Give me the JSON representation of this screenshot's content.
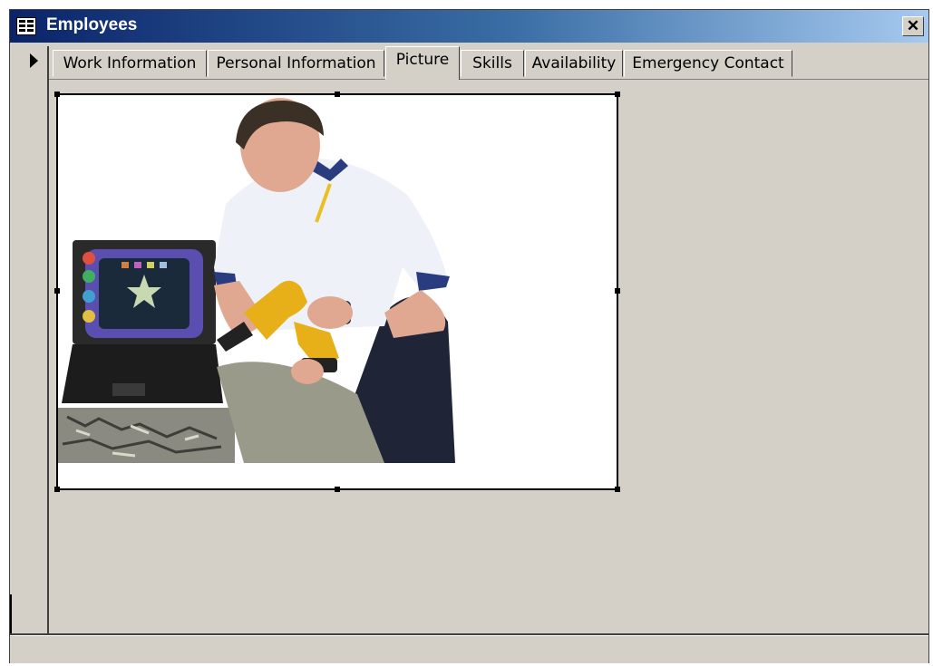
{
  "window": {
    "title": "Employees",
    "close_label": "✕"
  },
  "tabs": [
    {
      "label": "Work Information",
      "active": false
    },
    {
      "label": "Personal Information",
      "active": false
    },
    {
      "label": "Picture",
      "active": true
    },
    {
      "label": "Skills",
      "active": false
    },
    {
      "label": "Availability",
      "active": false
    },
    {
      "label": "Emergency Contact",
      "active": false
    }
  ],
  "picture": {
    "subject": "employee-photo"
  },
  "colors": {
    "titlebar_start": "#0a246a",
    "titlebar_end": "#a6caf0",
    "window_bg": "#d4d0c8",
    "picture_bg": "#ffffff"
  }
}
